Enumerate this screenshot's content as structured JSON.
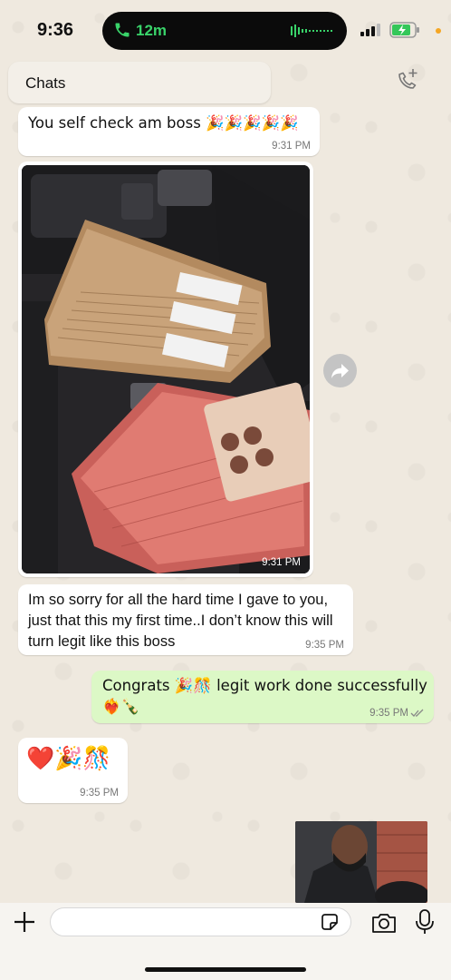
{
  "status": {
    "time": "9:36",
    "call_duration": "12m"
  },
  "header": {
    "chats_label": "Chats"
  },
  "messages": [
    {
      "text": "You self check am boss 🎉🎉🎉🎉🎉",
      "time": "9:31 PM"
    },
    {
      "photo_time": "9:31 PM"
    },
    {
      "text": "Im so sorry for all the hard time I gave to you, just that this my first time..I don’t know this will turn legit like this boss",
      "time": "9:35 PM"
    },
    {
      "text_line1": "Congrats 🎉🎊 legit work done successfully",
      "text_line2": "❤️‍🔥🍾",
      "time": "9:35 PM"
    },
    {
      "text": "❤️🎉🎊",
      "time": "9:35 PM"
    }
  ],
  "colors": {
    "incoming": "#ffffff",
    "outgoing": "#dcf8c6",
    "call_green": "#39d36a",
    "wallpaper": "#efe9df"
  },
  "icons": {
    "add_call": "phone-plus-icon",
    "forward": "forward-icon",
    "plus": "plus-icon",
    "sticker": "sticker-icon",
    "camera": "camera-icon",
    "mic": "mic-icon"
  }
}
